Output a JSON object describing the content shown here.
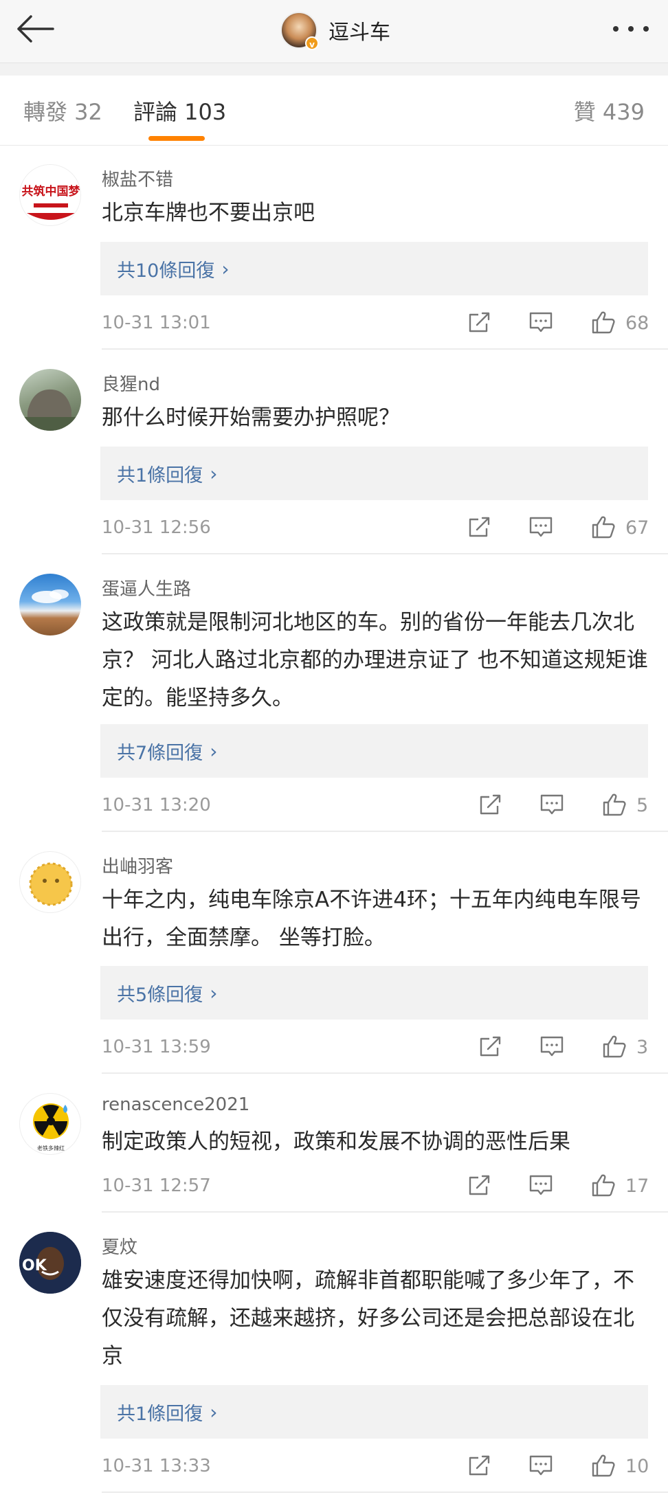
{
  "header": {
    "back_icon": "back-arrow-icon",
    "title": "逗斗车",
    "verified_badge": "v",
    "more_icon": "more-dots-icon"
  },
  "tabs": {
    "repost": "轉發 32",
    "comments": "評論 103",
    "likes": "贊 439",
    "accent": "#ff8200"
  },
  "comments": [
    {
      "username": "椒盐不错",
      "text": "北京车牌也不要出京吧",
      "replies": "共10條回復",
      "time": "10-31 13:01",
      "likes": "68",
      "avatar_text": "共筑中国梦"
    },
    {
      "username": "良猩nd",
      "text": "那什么时候开始需要办护照呢？",
      "replies": "共1條回復",
      "time": "10-31 12:56",
      "likes": "67"
    },
    {
      "username": "蛋逼人生路",
      "text": "这政策就是限制河北地区的车。别的省份一年能去几次北京？ 河北人路过北京都的办理进京证了 也不知道这规矩谁定的。能坚持多久。",
      "replies": "共7條回復",
      "time": "10-31 13:20",
      "likes": "5"
    },
    {
      "username": "出岫羽客",
      "text": "十年之内，纯电车除京A不许进4环；十五年内纯电车限号出行，全面禁摩。 坐等打脸。",
      "replies": "共5條回復",
      "time": "10-31 13:59",
      "likes": "3"
    },
    {
      "username": "renascence2021",
      "text": "制定政策人的短视，政策和发展不协调的恶性后果",
      "time": "10-31 12:57",
      "likes": "17",
      "avatar_text": "老铁多辣红"
    },
    {
      "username": "夏炆",
      "text": "雄安速度还得加快啊，疏解非首都职能喊了多少年了，不仅没有疏解，还越来越挤，好多公司还是会把总部设在北京",
      "replies": "共1條回復",
      "time": "10-31 13:33",
      "likes": "10",
      "avatar_text": "OK"
    }
  ],
  "icons": {
    "share": "share-icon",
    "comment": "comment-icon",
    "like": "thumbs-up-icon"
  }
}
